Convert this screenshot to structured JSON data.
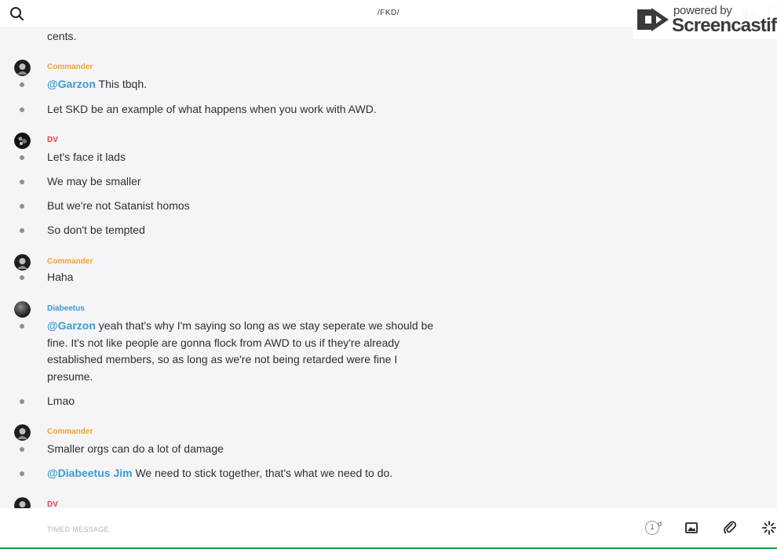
{
  "header": {
    "channel_title": "/FKD/",
    "watermark_small": "powered by",
    "watermark_big": "Screencastify"
  },
  "colors": {
    "commander": "#f0a335",
    "dv": "#e0434a",
    "diabeetus": "#3a9bd2",
    "mention": "#3a9bd2"
  },
  "feed": {
    "cutoff_text": "cents.",
    "groups": [
      {
        "author": "Commander",
        "messages": [
          {
            "mention": "@Garzon",
            "text": " This tbqh."
          },
          {
            "mention": "",
            "text": "Let SKD be an example of what happens when you work with AWD."
          }
        ]
      },
      {
        "author": "DV",
        "messages": [
          {
            "mention": "",
            "text": "Let's face it lads"
          },
          {
            "mention": "",
            "text": "We may be smaller"
          },
          {
            "mention": "",
            "text": "But we're not Satanist homos"
          },
          {
            "mention": "",
            "text": "So don't be tempted"
          }
        ]
      },
      {
        "author": "Commander",
        "messages": [
          {
            "mention": "",
            "text": "Haha"
          }
        ]
      },
      {
        "author": "Diabeetus",
        "messages": [
          {
            "mention": "@Garzon",
            "text": " yeah that's why I'm saying so long as we stay seperate we should be fine. It's not like people are gonna flock from AWD to us if they're already established members, so as long as we're not being retarded were fine I presume."
          },
          {
            "mention": "",
            "text": "Lmao"
          }
        ]
      },
      {
        "author": "Commander",
        "messages": [
          {
            "mention": "",
            "text": "Smaller orgs can do a lot of damage"
          },
          {
            "mention": "@Diabeetus Jim",
            "text": " We need to stick together, that's what we need to do."
          }
        ]
      },
      {
        "author": "DV",
        "messages": []
      }
    ]
  },
  "composer": {
    "placeholder": "TIMED MESSAGE",
    "timer_value": "1",
    "timer_unit": "d"
  }
}
